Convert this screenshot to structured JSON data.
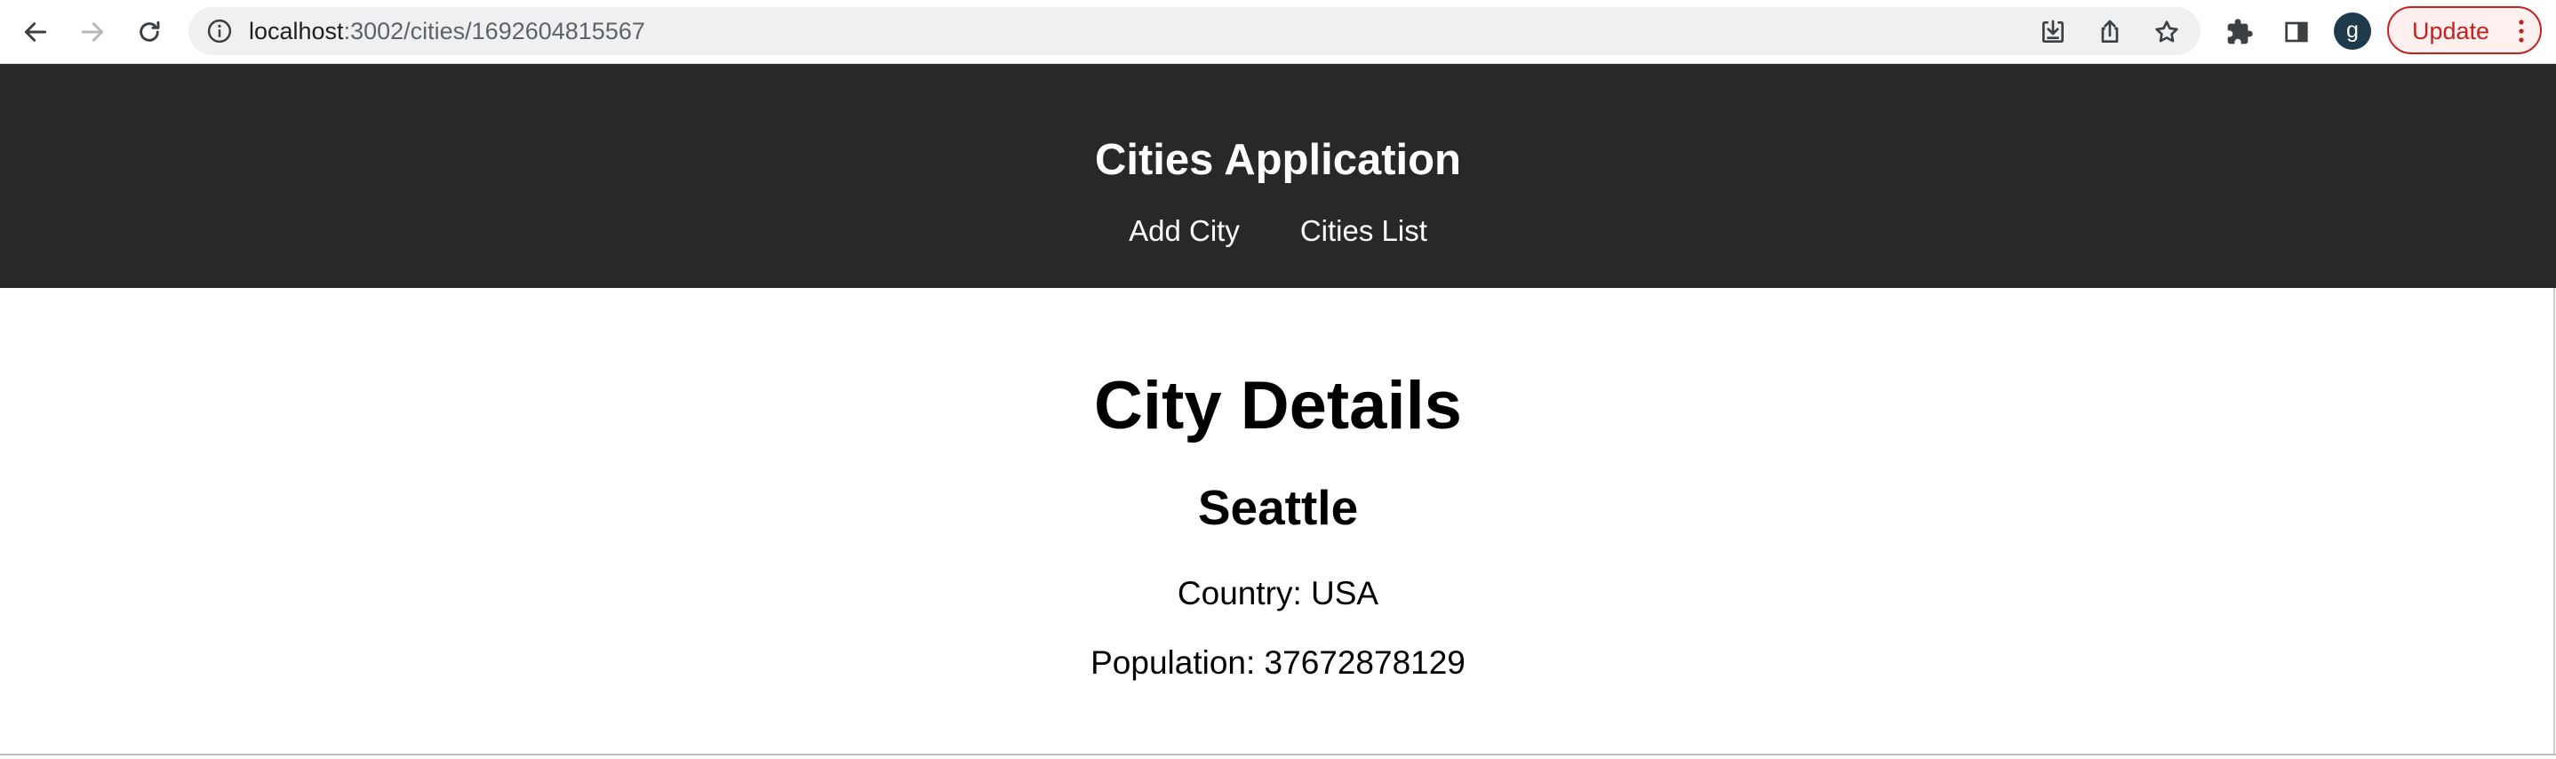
{
  "browser": {
    "url_host": "localhost",
    "url_path": ":3002/cities/1692604815567",
    "profile_initial": "g",
    "update_label": "Update",
    "icons": {
      "back": "back-arrow-icon",
      "forward": "forward-arrow-icon",
      "reload": "reload-icon",
      "info": "info-icon",
      "install": "install-icon",
      "share": "share-icon",
      "bookmark": "star-icon",
      "extensions": "puzzle-icon",
      "side_panel": "side-panel-icon",
      "menu": "kebab-menu-icon"
    },
    "accent_color": "#c5221f"
  },
  "header": {
    "title": "Cities Application",
    "nav": [
      {
        "label": "Add City"
      },
      {
        "label": "Cities List"
      }
    ],
    "background": "#282828"
  },
  "main": {
    "page_title": "City Details",
    "city_name": "Seattle",
    "country_line": "Country: USA",
    "population_line": "Population: 37672878129"
  }
}
